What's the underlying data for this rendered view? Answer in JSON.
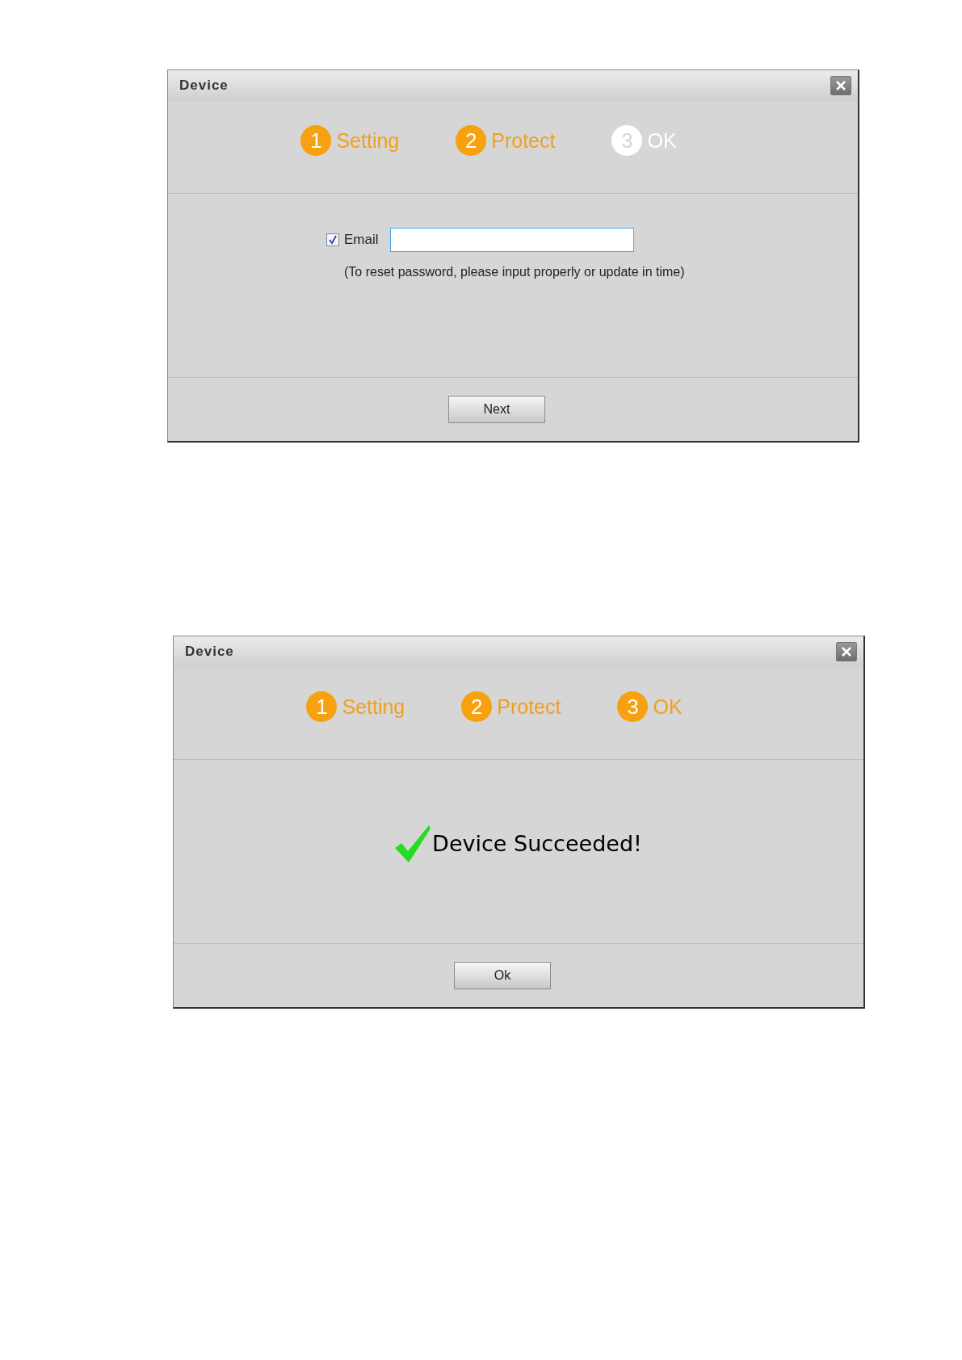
{
  "dialogs": [
    {
      "title": "Device",
      "steps": [
        {
          "number": "1",
          "label": "Setting",
          "completed": true
        },
        {
          "number": "2",
          "label": "Protect",
          "completed": true
        },
        {
          "number": "3",
          "label": "OK",
          "completed": false
        }
      ],
      "body": {
        "kind": "email_form",
        "checkbox_label": "Email",
        "checked": true,
        "note": "(To reset password, please input properly or update in time)"
      },
      "button": "Next"
    },
    {
      "title": "Device",
      "steps": [
        {
          "number": "1",
          "label": "Setting",
          "completed": true
        },
        {
          "number": "2",
          "label": "Protect",
          "completed": true
        },
        {
          "number": "3",
          "label": "OK",
          "completed": true
        }
      ],
      "body": {
        "kind": "result",
        "message": "Device Succeeded!"
      },
      "button": "Ok"
    }
  ]
}
